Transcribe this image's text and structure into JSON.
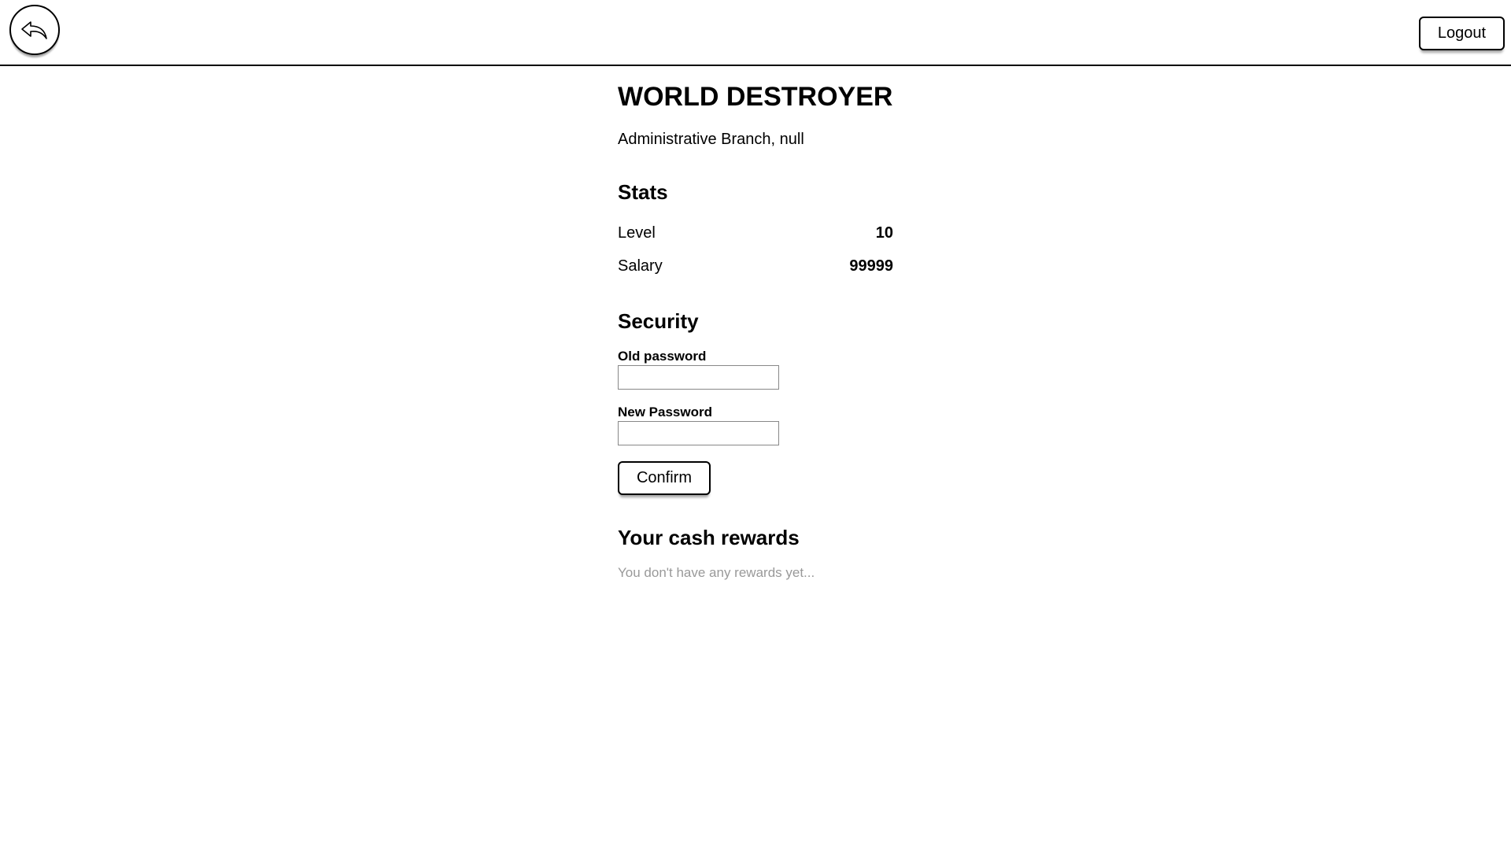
{
  "header": {
    "back_icon": "reply-arrow-icon",
    "logout_label": "Logout"
  },
  "profile": {
    "name": "WORLD DESTROYER",
    "subtitle": "Administrative Branch, null"
  },
  "stats": {
    "heading": "Stats",
    "rows": [
      {
        "label": "Level",
        "value": "10"
      },
      {
        "label": "Salary",
        "value": "99999"
      }
    ]
  },
  "security": {
    "heading": "Security",
    "old_password_label": "Old password",
    "old_password_value": "",
    "new_password_label": "New Password",
    "new_password_value": "",
    "confirm_label": "Confirm"
  },
  "rewards": {
    "heading": "Your cash rewards",
    "empty_text": "You don't have any rewards yet..."
  }
}
